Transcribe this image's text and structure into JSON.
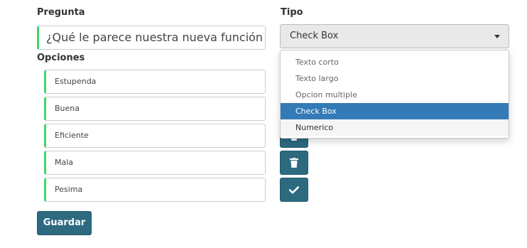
{
  "form": {
    "question_label": "Pregunta",
    "question_value": "¿Qué le parece nuestra nueva función",
    "type_label": "Tipo",
    "type_selected": "Check Box",
    "options_label": "Opciones",
    "options": [
      "Estupenda",
      "Buena",
      "Eficiente",
      "Mala",
      "Pesima"
    ],
    "save_label": "Guardar"
  },
  "dropdown": {
    "items": [
      "Texto corto",
      "Texto largo",
      "Opcion multiple",
      "Check Box",
      "Numerico"
    ],
    "selected_index": 3,
    "hover_index": 4
  },
  "colors": {
    "accent_border": "#3ed66a",
    "button_bg": "#2d6a80",
    "selected_bg": "#337ab7"
  },
  "icons": {
    "delete": "trash-icon",
    "confirm": "check-icon"
  }
}
